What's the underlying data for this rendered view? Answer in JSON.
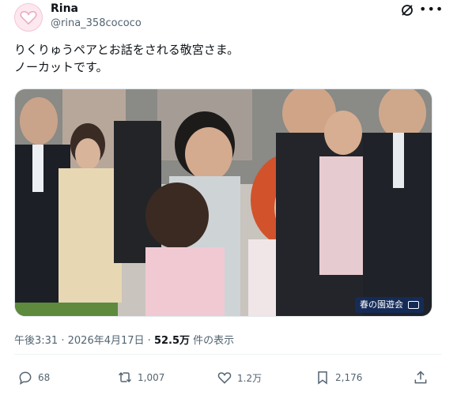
{
  "author": {
    "name": "Rina",
    "handle": "@rina_358cococo",
    "avatar_icon": "heart-icon"
  },
  "post": {
    "text_line1": "りくりゅうペアとお話をされる敬宮さま。",
    "text_line2": "ノーカットです。"
  },
  "media": {
    "caption": "春の園遊会"
  },
  "meta": {
    "time": "午後3:31",
    "separator": "·",
    "date": "2026年4月17日",
    "separator2": "·",
    "views_count": "52.5万",
    "views_label": "件の表示"
  },
  "actions": {
    "replies": "68",
    "reposts": "1,007",
    "likes": "1.2万",
    "bookmarks": "2,176"
  },
  "colors": {
    "text": "#0f1419",
    "secondary": "#536471",
    "caption_bg": "#142d5f"
  }
}
